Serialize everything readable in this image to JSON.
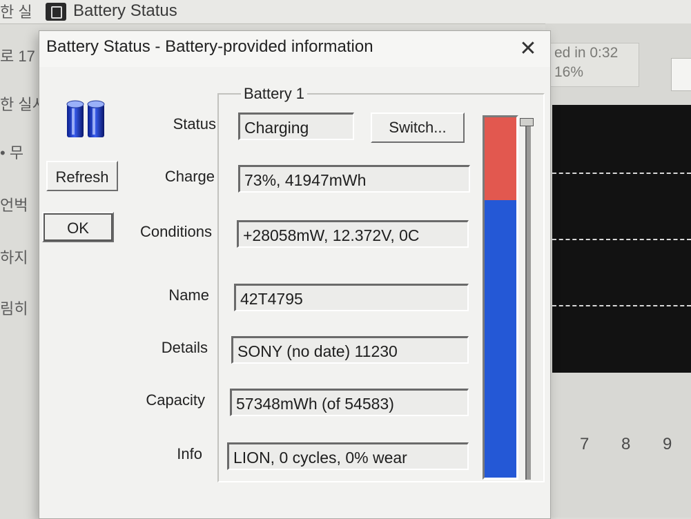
{
  "background_window": {
    "title": "Battery Status",
    "left_fragments": [
      "한 실",
      "로 17",
      "한 실시",
      "• 무",
      "언벅",
      "하지",
      "림히"
    ],
    "status_lines": [
      "ed in 0:32",
      "16%"
    ],
    "axis_numbers": [
      "7",
      "8",
      "9"
    ]
  },
  "dialog": {
    "title": "Battery Status - Battery-provided information",
    "close_symbol": "✕",
    "buttons": {
      "refresh": "Refresh",
      "ok": "OK",
      "switch": "Switch..."
    },
    "group_title": "Battery 1",
    "labels": {
      "status": "Status",
      "charge": "Charge",
      "conditions": "Conditions",
      "name": "Name",
      "details": "Details",
      "capacity": "Capacity",
      "info": "Info"
    },
    "values": {
      "status": "Charging",
      "charge": "73%, 41947mWh",
      "conditions": "+28058mW, 12.372V, 0C",
      "name": "42T4795",
      "details": "SONY (no date) 11230",
      "capacity": "57348mWh (of 54583)",
      "info": "LION, 0 cycles, 0% wear"
    },
    "charge_level_fraction": 0.77,
    "colors": {
      "level_empty": "#e2584f",
      "level_full": "#2458d6"
    },
    "icon": "battery-cells-icon"
  }
}
